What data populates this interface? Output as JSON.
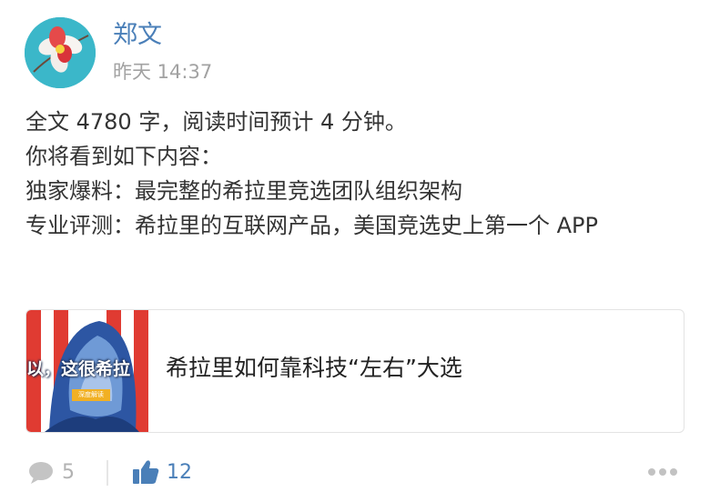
{
  "post": {
    "author": "郑文",
    "timestamp": "昨天 14:37",
    "avatar_icon": "flower-avatar-icon",
    "body_lines": [
      "全文 4780 字，阅读时间预计 4 分钟。",
      "你将看到如下内容：",
      "独家爆料：最完整的希拉里竞选团队组织架构",
      "专业评测：希拉里的互联网产品，美国竞选史上第一个 APP"
    ]
  },
  "article_card": {
    "title": "希拉里如何靠科技“左右”大选",
    "thumbnail_text": "以，这很希拉",
    "thumbnail_badge": "深度解读"
  },
  "actions": {
    "comment_icon": "comment-bubble-icon",
    "comment_count": "5",
    "like_icon": "thumbs-up-icon",
    "like_count": "12",
    "more_icon": "more-dots-icon"
  },
  "colors": {
    "link_blue": "#4a7fb8",
    "muted_gray": "#a2a2a2",
    "text": "#333333",
    "avatar_bg": "#3bb7c9"
  }
}
